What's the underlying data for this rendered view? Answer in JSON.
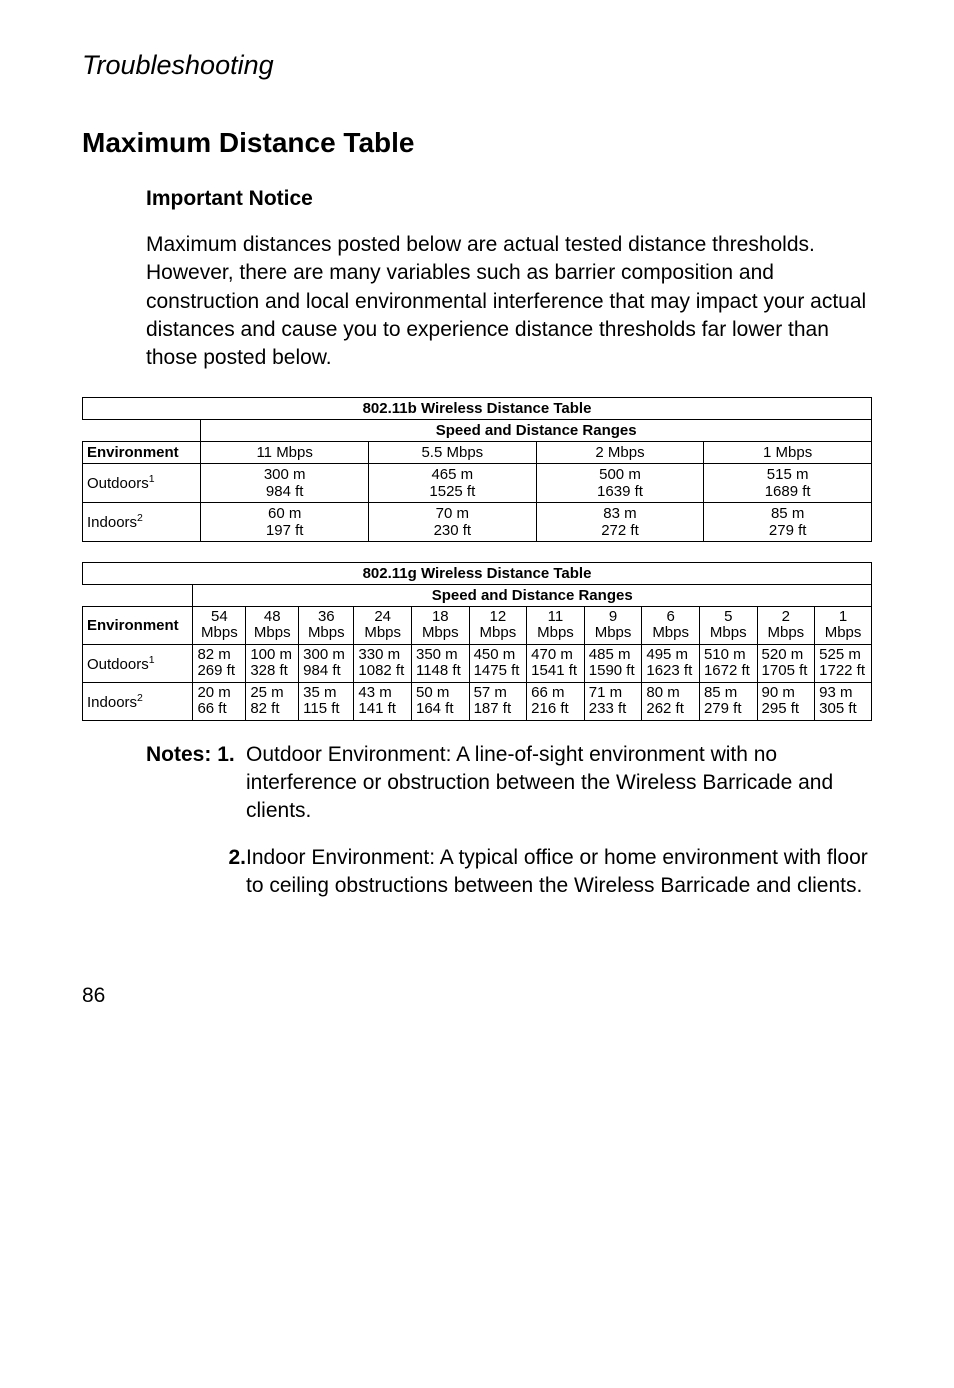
{
  "section": "Troubleshooting",
  "title": "Maximum Distance Table",
  "notice_heading": "Important Notice",
  "notice_body": "Maximum distances posted below are actual tested distance thresholds. However, there are many variables such as barrier composition and construction and local environmental interference that may impact your actual distances and cause you to experience distance thresholds far lower than those posted below.",
  "table_b": {
    "title": "802.11b Wireless Distance Table",
    "ranges_header": "Speed and Distance Ranges",
    "env_header": "Environment",
    "speeds": [
      "11 Mbps",
      "5.5 Mbps",
      "2 Mbps",
      "1 Mbps"
    ],
    "rows": [
      {
        "label": "Outdoors",
        "sup": "1",
        "cells": [
          "300 m\n984 ft",
          "465 m\n1525 ft",
          "500 m\n1639 ft",
          "515 m\n1689 ft"
        ]
      },
      {
        "label": "Indoors",
        "sup": "2",
        "cells": [
          "60 m\n197 ft",
          "70 m\n230 ft",
          "83 m\n272 ft",
          "85 m\n279 ft"
        ]
      }
    ]
  },
  "table_g": {
    "title": "802.11g Wireless Distance Table",
    "ranges_header": "Speed and Distance Ranges",
    "env_header": "Environment",
    "speeds": [
      "54\nMbps",
      "48\nMbps",
      "36\nMbps",
      "24\nMbps",
      "18\nMbps",
      "12\nMbps",
      "11\nMbps",
      "9\nMbps",
      "6\nMbps",
      "5\nMbps",
      "2\nMbps",
      "1\nMbps"
    ],
    "rows": [
      {
        "label": "Outdoors",
        "sup": "1",
        "cells": [
          "82 m\n269 ft",
          "100 m\n328 ft",
          "300 m\n984 ft",
          "330 m\n1082 ft",
          "350 m\n1148 ft",
          "450 m\n1475 ft",
          "470 m\n1541 ft",
          "485 m\n1590 ft",
          "495 m\n1623 ft",
          "510 m\n1672 ft",
          "520 m\n1705 ft",
          "525 m\n1722 ft"
        ]
      },
      {
        "label": "Indoors",
        "sup": "2",
        "cells": [
          "20 m\n66 ft",
          "25 m\n82 ft",
          "35 m\n115 ft",
          "43 m\n141 ft",
          "50 m\n164 ft",
          "57 m\n187 ft",
          "66 m\n216 ft",
          "71 m\n233 ft",
          "80 m\n262 ft",
          "85 m\n279 ft",
          "90 m\n295 ft",
          "93 m\n305 ft"
        ]
      }
    ]
  },
  "notes_label": "Notes:",
  "notes": [
    {
      "num": "1.",
      "text": "Outdoor Environment: A line-of-sight environment with no interference or obstruction between the Wireless Barricade and clients."
    },
    {
      "num": "2.",
      "text": "Indoor Environment: A typical office or home environment with floor to ceiling obstructions between the Wireless Barricade and clients."
    }
  ],
  "page_number": "86",
  "chart_data": [
    {
      "type": "table",
      "title": "802.11b Wireless Distance Table — Speed and Distance Ranges",
      "xlabel": "Speed",
      "ylabel": "Distance",
      "categories": [
        "11 Mbps",
        "5.5 Mbps",
        "2 Mbps",
        "1 Mbps"
      ],
      "series": [
        {
          "name": "Outdoors (m)",
          "values": [
            300,
            465,
            500,
            515
          ]
        },
        {
          "name": "Outdoors (ft)",
          "values": [
            984,
            1525,
            1639,
            1689
          ]
        },
        {
          "name": "Indoors (m)",
          "values": [
            60,
            70,
            83,
            85
          ]
        },
        {
          "name": "Indoors (ft)",
          "values": [
            197,
            230,
            272,
            279
          ]
        }
      ]
    },
    {
      "type": "table",
      "title": "802.11g Wireless Distance Table — Speed and Distance Ranges",
      "xlabel": "Speed (Mbps)",
      "ylabel": "Distance",
      "categories": [
        54,
        48,
        36,
        24,
        18,
        12,
        11,
        9,
        6,
        5,
        2,
        1
      ],
      "series": [
        {
          "name": "Outdoors (m)",
          "values": [
            82,
            100,
            300,
            330,
            350,
            450,
            470,
            485,
            495,
            510,
            520,
            525
          ]
        },
        {
          "name": "Outdoors (ft)",
          "values": [
            269,
            328,
            984,
            1082,
            1148,
            1475,
            1541,
            1590,
            1623,
            1672,
            1705,
            1722
          ]
        },
        {
          "name": "Indoors (m)",
          "values": [
            20,
            25,
            35,
            43,
            50,
            57,
            66,
            71,
            80,
            85,
            90,
            93
          ]
        },
        {
          "name": "Indoors (ft)",
          "values": [
            66,
            82,
            115,
            141,
            164,
            187,
            216,
            233,
            262,
            279,
            295,
            305
          ]
        }
      ]
    }
  ]
}
